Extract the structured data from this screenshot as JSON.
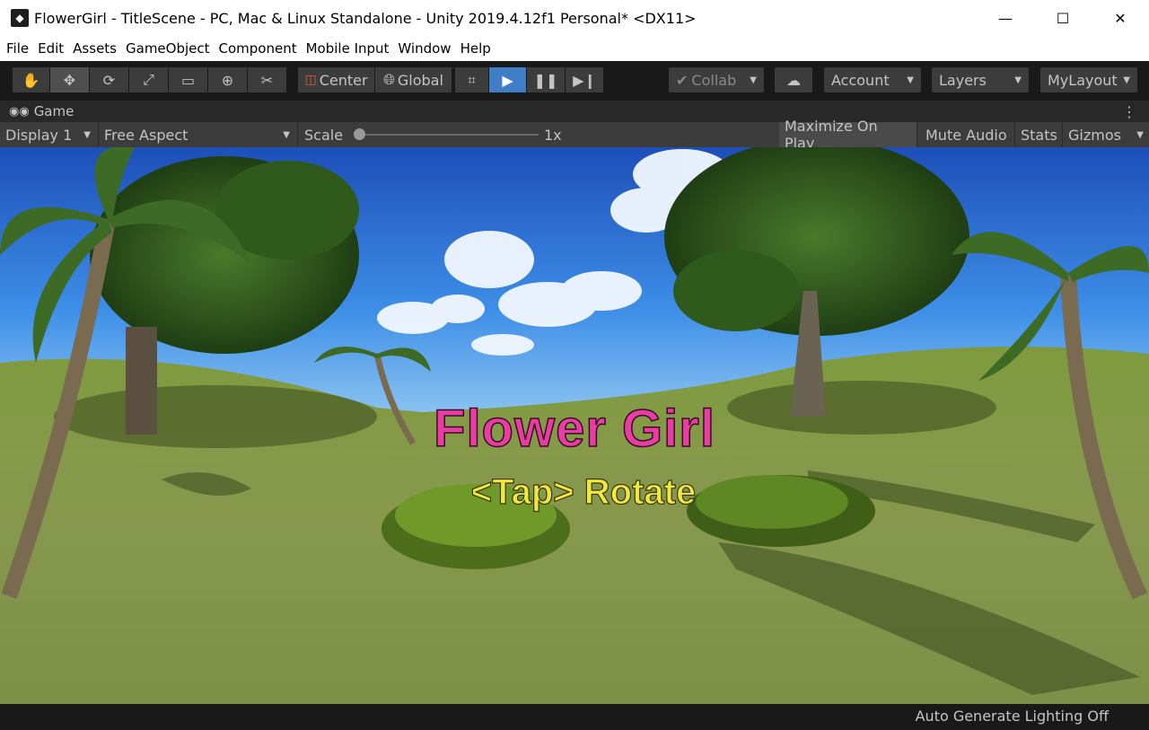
{
  "window": {
    "title": "FlowerGirl - TitleScene - PC, Mac & Linux Standalone - Unity 2019.4.12f1 Personal* <DX11>",
    "minimize": "—",
    "maximize": "☐",
    "close": "✕"
  },
  "menu": [
    "File",
    "Edit",
    "Assets",
    "GameObject",
    "Component",
    "Mobile Input",
    "Window",
    "Help"
  ],
  "toolbar": {
    "tools": [
      {
        "name": "hand-tool",
        "icon": "hand-icon",
        "glyph": "✋"
      },
      {
        "name": "move-tool",
        "icon": "move-icon",
        "glyph": "✥"
      },
      {
        "name": "rotate-tool",
        "icon": "rotate-icon",
        "glyph": "⟳"
      },
      {
        "name": "scale-tool",
        "icon": "scale-icon",
        "glyph": "⤢"
      },
      {
        "name": "rect-tool",
        "icon": "rect-icon",
        "glyph": "▭"
      },
      {
        "name": "transform-tool",
        "icon": "transform-icon",
        "glyph": "⊕"
      },
      {
        "name": "custom-tool",
        "icon": "tools-icon",
        "glyph": "✂"
      }
    ],
    "pivot_label": "Center",
    "space_label": "Global",
    "collab_label": "Collab",
    "account_label": "Account",
    "layers_label": "Layers",
    "layout_label": "MyLayout",
    "play_active": true
  },
  "game_tab": {
    "label": "Game"
  },
  "game_controls": {
    "display": "Display 1",
    "aspect": "Free Aspect",
    "scale_label": "Scale",
    "scale_value": "1x",
    "maximize_on_play": "Maximize On Play",
    "mute_audio": "Mute Audio",
    "stats": "Stats",
    "gizmos": "Gizmos"
  },
  "game_view": {
    "title": "Flower Girl",
    "subtitle": "<Tap> Rotate"
  },
  "status": {
    "lighting": "Auto Generate Lighting Off"
  },
  "colors": {
    "accent_play": "#3f7dc7",
    "title_pink": "#e83ea3",
    "subtitle_yellow": "#f0e840"
  }
}
